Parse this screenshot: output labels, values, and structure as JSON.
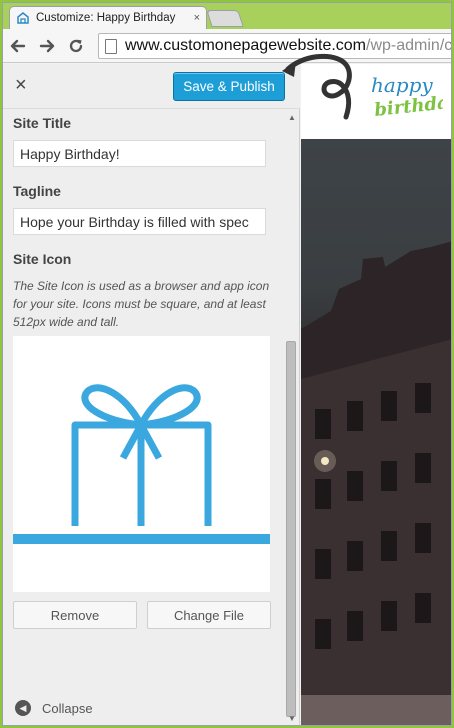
{
  "browser": {
    "tab_title": "Customize: Happy Birthday",
    "tab_close": "×",
    "url_host": "www.customonepagewebsite.com",
    "url_path": "/wp-admin/c"
  },
  "customizer": {
    "close_label": "×",
    "publish_label": "Save & Publish",
    "site_title_label": "Site Title",
    "site_title_value": "Happy Birthday!",
    "tagline_label": "Tagline",
    "tagline_value": "Hope your Birthday is filled with spec",
    "site_icon_label": "Site Icon",
    "site_icon_description": "The Site Icon is used as a browser and app icon for your site. Icons must be square, and at least 512px wide and tall.",
    "remove_label": "Remove",
    "change_file_label": "Change File",
    "collapse_label": "Collapse"
  },
  "preview": {
    "logo_line1": "happy",
    "logo_line2": "birthday"
  },
  "colors": {
    "accent": "#1e9ed6",
    "gift_icon": "#3aa7df",
    "chrome_green": "#8ec63f",
    "logo_blue": "#2b8ac6",
    "logo_green": "#7dc242"
  },
  "icons": [
    "tab-favicon-icon",
    "back-arrow-icon",
    "forward-arrow-icon",
    "reload-icon",
    "page-icon",
    "gift-icon",
    "collapse-icon",
    "annotation-arrow-icon"
  ]
}
